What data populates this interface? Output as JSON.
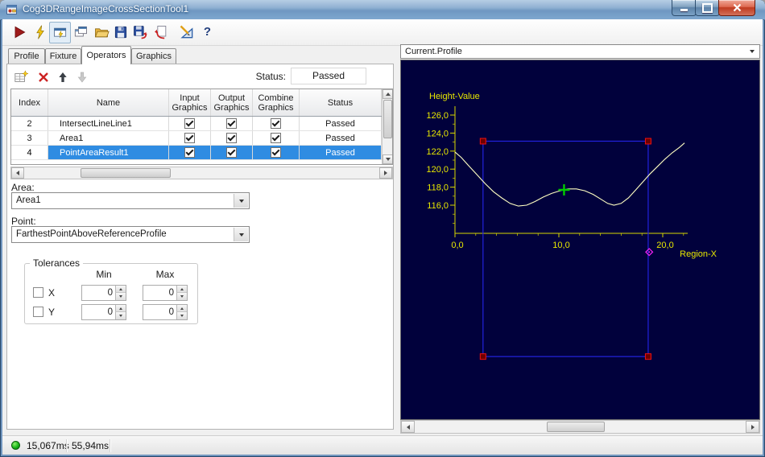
{
  "window": {
    "title": "Cog3DRangeImageCrossSectionTool1"
  },
  "tabs": {
    "items": [
      {
        "label": "Profile"
      },
      {
        "label": "Fixture"
      },
      {
        "label": "Operators"
      },
      {
        "label": "Graphics"
      }
    ]
  },
  "operator_toolbar": {
    "status_label": "Status:",
    "status_value": "Passed"
  },
  "grid": {
    "headers": {
      "index": "Index",
      "name": "Name",
      "input": "Input Graphics",
      "output": "Output Graphics",
      "combine": "Combine Graphics",
      "status": "Status"
    },
    "rows": [
      {
        "index": "2",
        "name": "IntersectLineLine1",
        "status": "Passed"
      },
      {
        "index": "3",
        "name": "Area1",
        "status": "Passed"
      },
      {
        "index": "4",
        "name": "PointAreaResult1",
        "status": "Passed"
      }
    ]
  },
  "area": {
    "label": "Area:",
    "value": "Area1"
  },
  "point": {
    "label": "Point:",
    "value": "FarthestPointAboveReferenceProfile"
  },
  "tolerances": {
    "title": "Tolerances",
    "min_header": "Min",
    "max_header": "Max",
    "x_label": "X",
    "y_label": "Y",
    "x_min": "0",
    "x_max": "0",
    "y_min": "0",
    "y_max": "0"
  },
  "profile_selector": {
    "value": "Current.Profile"
  },
  "status_bar": {
    "time1": "15,067ms",
    "time2": "55,94ms"
  },
  "icons": {
    "help_glyph": "?"
  },
  "chart_data": {
    "type": "line",
    "ylabel": "Height-Value",
    "xlabel": "Region-X",
    "bg": "#01013c",
    "axis_color": "#d6d600",
    "label_color": "#e8e800",
    "curve_color": "#ffffc2",
    "xlim": [
      0,
      22.5
    ],
    "ylim": [
      113,
      127
    ],
    "x_ticks": [
      {
        "v": 0,
        "label": "0,0"
      },
      {
        "v": 10,
        "label": "10,0"
      },
      {
        "v": 20,
        "label": "20,0"
      }
    ],
    "y_ticks": [
      {
        "v": 126,
        "label": "126,0"
      },
      {
        "v": 124,
        "label": "124,0"
      },
      {
        "v": 122,
        "label": "122,0"
      },
      {
        "v": 120,
        "label": "120,0"
      },
      {
        "v": 118,
        "label": "118,0"
      },
      {
        "v": 116,
        "label": "116,0"
      }
    ],
    "series": [
      {
        "name": "profile",
        "points": [
          [
            0,
            121.9
          ],
          [
            0.6,
            121.3
          ],
          [
            1.3,
            120.4
          ],
          [
            2.1,
            119.4
          ],
          [
            2.9,
            118.4
          ],
          [
            3.7,
            117.5
          ],
          [
            4.5,
            116.8
          ],
          [
            5.3,
            116.2
          ],
          [
            6.1,
            115.9
          ],
          [
            6.9,
            116.0
          ],
          [
            7.7,
            116.4
          ],
          [
            8.5,
            116.9
          ],
          [
            9.3,
            117.3
          ],
          [
            10.1,
            117.6
          ],
          [
            10.9,
            117.8
          ],
          [
            11.7,
            117.8
          ],
          [
            12.5,
            117.6
          ],
          [
            13.3,
            117.2
          ],
          [
            14.0,
            116.7
          ],
          [
            14.7,
            116.2
          ],
          [
            15.3,
            116.0
          ],
          [
            16.0,
            116.2
          ],
          [
            16.7,
            116.8
          ],
          [
            17.4,
            117.7
          ],
          [
            18.1,
            118.6
          ],
          [
            18.8,
            119.5
          ],
          [
            19.5,
            120.3
          ],
          [
            20.2,
            121.1
          ],
          [
            20.9,
            121.8
          ],
          [
            21.6,
            122.4
          ],
          [
            22.1,
            122.9
          ]
        ]
      }
    ],
    "region": {
      "x1": 2.7,
      "x2": 18.6,
      "y_top": 123.1,
      "y_bottom": 99.2,
      "color": "#2222dd",
      "handle_fill": "#6e0000",
      "handle_stroke": "#ee1111"
    },
    "markers": [
      {
        "type": "cross",
        "x": 10.5,
        "y": 117.7,
        "color": "#00cc00"
      },
      {
        "type": "pin",
        "x": 18.7,
        "y": 110.8,
        "color": "#ee22ee"
      }
    ]
  }
}
